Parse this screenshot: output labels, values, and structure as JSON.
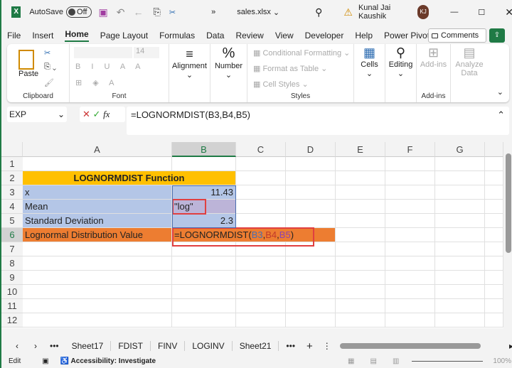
{
  "titlebar": {
    "autosave": "AutoSave",
    "toggle": "Off",
    "filename": "sales.xlsx",
    "user": "Kunal Jai Kaushik",
    "initials": "KJ"
  },
  "menu": [
    "File",
    "Insert",
    "Home",
    "Page Layout",
    "Formulas",
    "Data",
    "Review",
    "View",
    "Developer",
    "Help",
    "Power Pivot"
  ],
  "comments": "Comments",
  "ribbon": {
    "paste": "Paste",
    "clipboard": "Clipboard",
    "font_size": "14",
    "font": "Font",
    "alignment": "Alignment",
    "number": "Number",
    "cond_fmt": "Conditional Formatting",
    "fmt_table": "Format as Table",
    "cell_styles": "Cell Styles",
    "styles": "Styles",
    "cells": "Cells",
    "editing": "Editing",
    "addins": "Add-ins",
    "analyze": "Analyze Data",
    "addins_group": "Add-ins"
  },
  "formula_bar": {
    "name_box": "EXP",
    "formula": "=LOGNORMDIST(B3,B4,B5)"
  },
  "columns": [
    "A",
    "B",
    "C",
    "D",
    "E",
    "F",
    "G"
  ],
  "rows": [
    "1",
    "2",
    "3",
    "4",
    "5",
    "6",
    "7",
    "8",
    "9",
    "10",
    "11",
    "12"
  ],
  "cells": {
    "title": "LOGNORMDIST Function",
    "a3": "x",
    "b3": "11.43",
    "a4": "Mean",
    "b4": "\"log\"",
    "a5": "Standard Deviation",
    "b5": "2.3",
    "a6": "Lognormal Distribution Value",
    "b6_pre": "=LOGNORMDIST(",
    "b6_r1": "B3",
    "b6_r2": "B4",
    "b6_r3": "B5",
    "b6_post": ")"
  },
  "colors": {
    "title_fill": "#ffc000",
    "blue_fill": "#b4c6e7",
    "orange_fill": "#ed7d31",
    "excel_green": "#1f7a45"
  },
  "sheets": [
    "Sheet17",
    "FDIST",
    "FINV",
    "LOGINV",
    "Sheet21"
  ],
  "status": {
    "mode": "Edit",
    "accessibility": "Accessibility: Investigate",
    "zoom": "100%"
  }
}
